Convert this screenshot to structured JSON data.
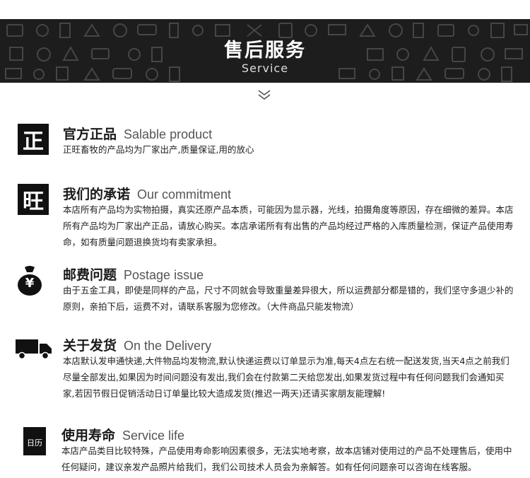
{
  "banner": {
    "title": "售后服务",
    "subtitle": "Service"
  },
  "sections": [
    {
      "icon_text": "正",
      "title_cn": "官方正品",
      "title_en": "Salable product",
      "body": "正旺畜牧的产品均为厂家出产,质量保证,用的放心"
    },
    {
      "icon_text": "旺",
      "title_cn": "我们的承诺",
      "title_en": "Our commitment",
      "body": "本店所有产品均为实物拍摄，真实还原产品本质，可能因为显示器，光线，拍摄角度等原因，存在细微的差异。本店所有产品均为厂家出产正品，请放心购买。本店承诺所有有出售的产品均经过严格的入库质量检测，保证产品使用寿命，如有质量问题退换货均有卖家承担。"
    },
    {
      "icon_text": "¥",
      "title_cn": "邮费问题",
      "title_en": "Postage issue",
      "body": "由于五金工具，即使是同样的产品，尺寸不同就会导致重量差异很大，所以运费部分都是错的，我们坚守多退少补的原则，亲拍下后，运费不对，请联系客服为您修改。（大件商品只能发物流）"
    },
    {
      "icon_text": "",
      "title_cn": "关于发货",
      "title_en": "On the Delivery",
      "body": "本店默认发申通快递,大件物品均发物流,默认快递运费以订单显示为准,每天4点左右统一配送发货,当天4点之前我们尽量全部发出,如果因为时间问题没有发出,我们会在付款第二天给您发出,如果发货过程中有任何问题我们会通知买家,若因节假日促销活动日订单量比较大造成发货(推迟一两天)还请买家朋友能理解!"
    },
    {
      "icon_text": "日历",
      "title_cn": "使用寿命",
      "title_en": "Service life",
      "body": "本店产品类目比较特殊，产品使用寿命影响因素很多，无法实地考察，故本店铺对使用过的产品不处理售后，使用中任何疑问，建议亲发产品照片给我们，我们公司技术人员会为亲解答。如有任何问题亲可以咨询在线客服。"
    }
  ]
}
